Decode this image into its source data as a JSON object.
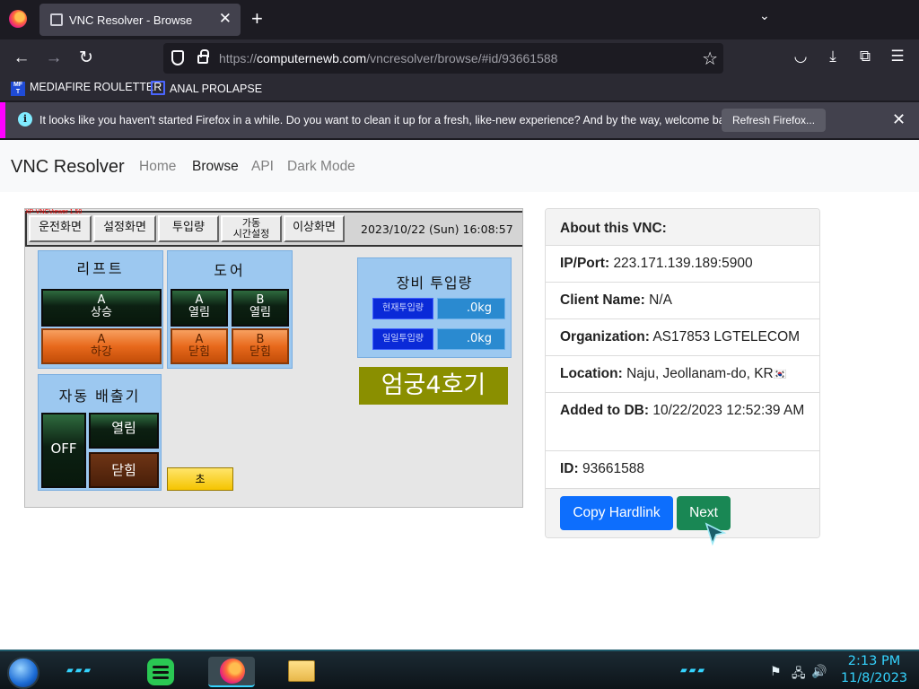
{
  "browser": {
    "tab_title": "VNC Resolver - Browse",
    "url_domain": "computernewb.com",
    "url_prefix": "https://",
    "url_path": "/vncresolver/browse/#id/93661588",
    "bookmarks": [
      {
        "label": "MEDIAFIRE ROULETTER",
        "icon": "mediafire-icon"
      },
      {
        "label": "ANAL PROLAPSE",
        "icon": "bookmark-icon"
      }
    ],
    "notification": {
      "message": "It looks like you haven't started Firefox in a while. Do you want to clean it up for a fresh, like-new experience? And by the way, welcome back!",
      "button": "Refresh Firefox..."
    }
  },
  "site": {
    "brand": "VNC Resolver",
    "nav": [
      {
        "label": "Home",
        "active": false
      },
      {
        "label": "Browse",
        "active": true
      },
      {
        "label": "API",
        "active": false
      },
      {
        "label": "Dark Mode",
        "active": false
      }
    ]
  },
  "vnc_screen": {
    "viewer_label": "XP-VNCViewer 1.50",
    "top_buttons": [
      "운전화면",
      "설정화면",
      "투입량",
      "가동\n시간설정",
      "이상화면"
    ],
    "datetime": "2023/10/22 (Sun) 16:08:57",
    "lift": {
      "title": "리프트",
      "up_line1": "A",
      "up_line2": "상승",
      "down_line1": "A",
      "down_line2": "하강"
    },
    "door": {
      "title": "도어",
      "a_open": [
        "A",
        "열림"
      ],
      "b_open": [
        "B",
        "열림"
      ],
      "a_close": [
        "A",
        "닫힘"
      ],
      "b_close": [
        "B",
        "닫힘"
      ]
    },
    "feed": {
      "title": "장비  투입량",
      "current_label": "현재투입량",
      "current_value": ".0kg",
      "daily_label": "일일투입량",
      "daily_value": ".0kg"
    },
    "machine_name": "엄궁4호기",
    "exhaust": {
      "title": "자동  배출기",
      "off_label": "OFF",
      "open_label": "열림",
      "close_label": "닫힘"
    },
    "seconds_label": "초"
  },
  "info": {
    "header": "About this VNC:",
    "rows": [
      {
        "key": "IP/Port:",
        "value": "223.171.139.189:5900"
      },
      {
        "key": "Client Name:",
        "value": "N/A"
      },
      {
        "key": "Organization:",
        "value": "AS17853 LGTELECOM"
      },
      {
        "key": "Location:",
        "value": "Naju, Jeollanam-do, KR",
        "flag": "🇰🇷"
      },
      {
        "key": "Added to DB:",
        "value": "10/22/2023 12:52:39 AM"
      },
      {
        "key": "ID:",
        "value": "93661588"
      }
    ],
    "copy_button": "Copy Hardlink",
    "next_button": "Next"
  },
  "taskbar": {
    "time": "2:13 PM",
    "date": "11/8/2023",
    "apps": [
      "spotify-icon",
      "firefox-icon",
      "file-explorer-icon"
    ]
  },
  "colors": {
    "primary": "#0d6efd",
    "success": "#198754",
    "browser_bg": "#1c1b22",
    "toolbar_bg": "#2b2a33"
  }
}
